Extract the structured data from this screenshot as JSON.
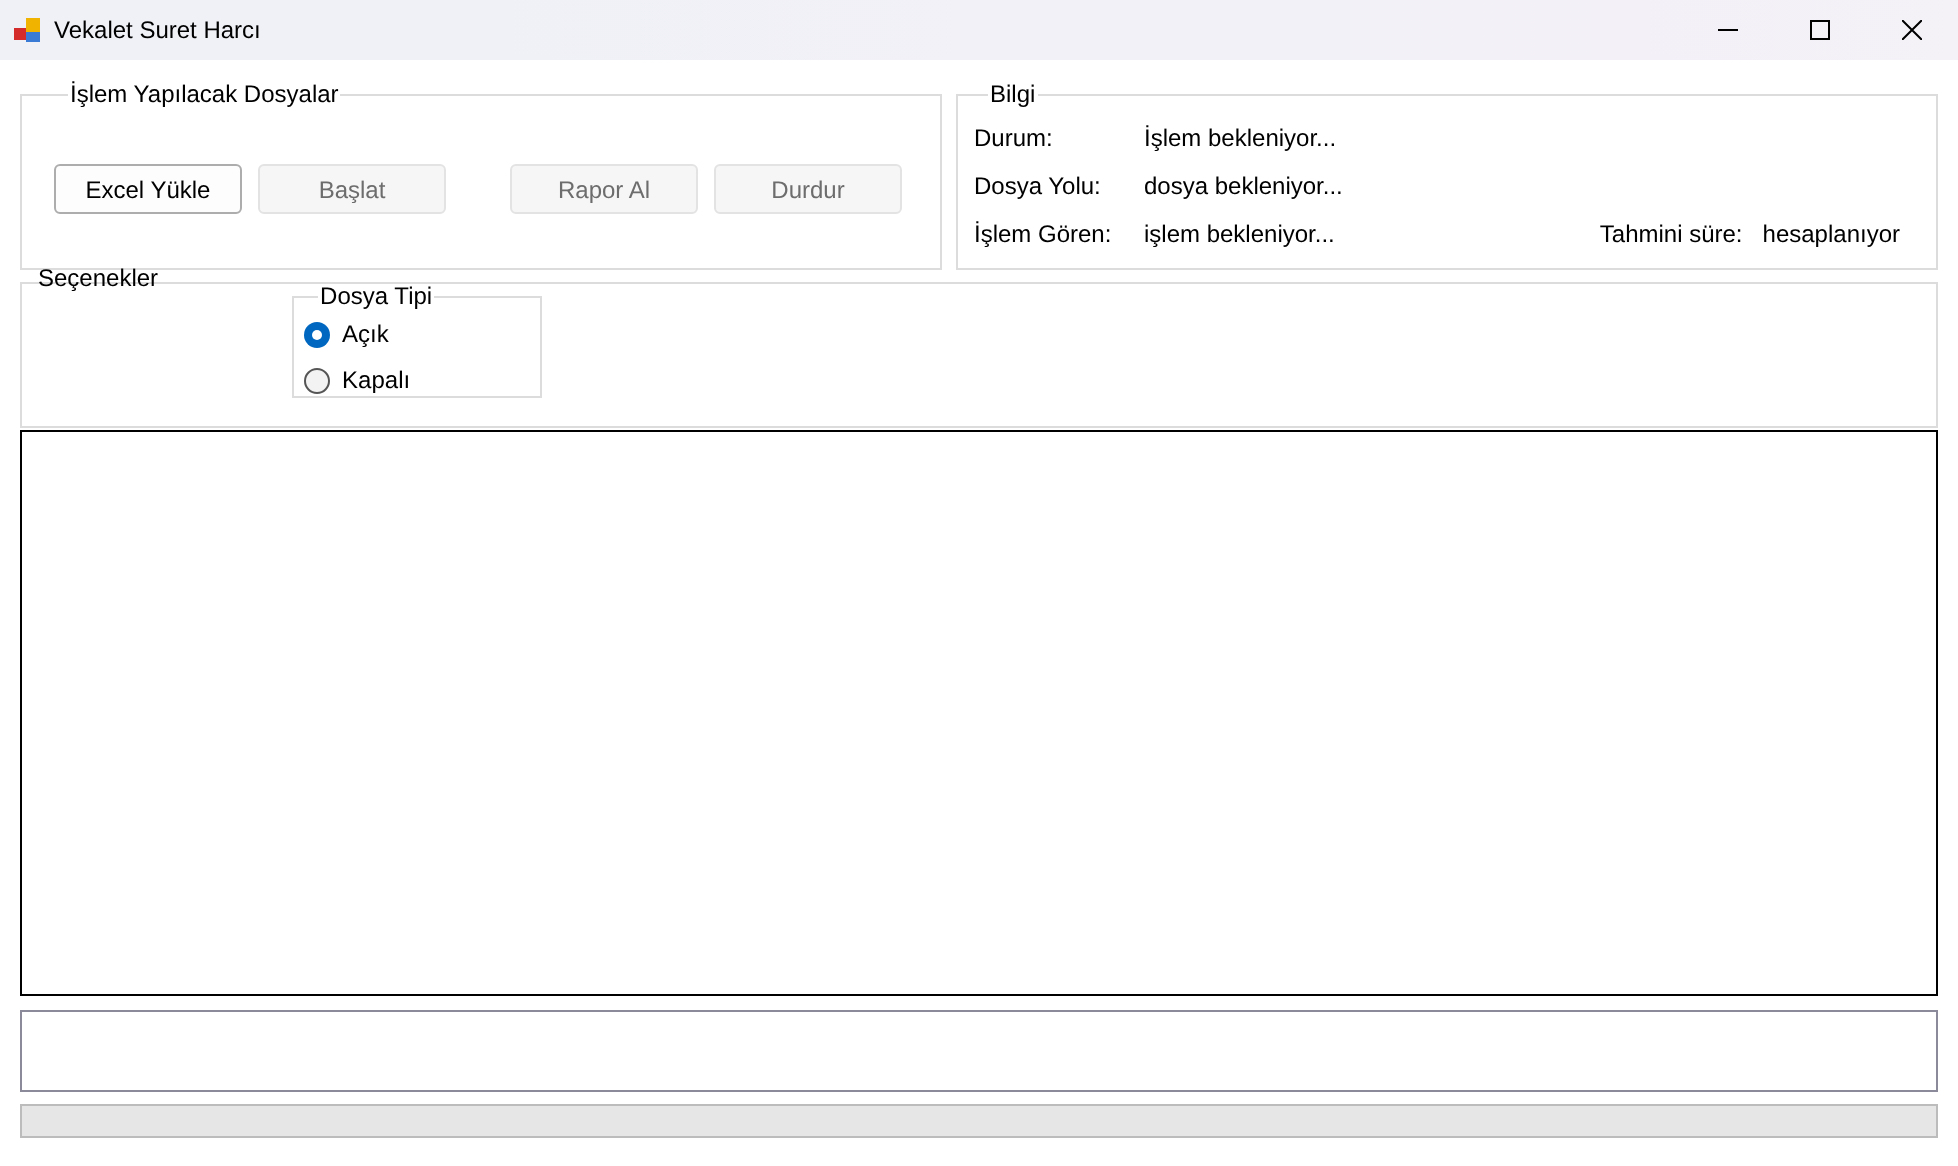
{
  "window": {
    "title": "Vekalet Suret Harcı"
  },
  "files_group": {
    "title": "İşlem Yapılacak Dosyalar",
    "buttons": [
      {
        "label": "Excel Yükle",
        "disabled": false
      },
      {
        "label": "Başlat",
        "disabled": true
      },
      {
        "label": "Rapor Al",
        "disabled": true
      },
      {
        "label": "Durdur",
        "disabled": true
      }
    ]
  },
  "info_group": {
    "title": "Bilgi",
    "rows": [
      {
        "label": "Durum:",
        "value": "İşlem bekleniyor..."
      },
      {
        "label": "Dosya Yolu:",
        "value": "dosya bekleniyor..."
      },
      {
        "label": "İşlem Gören:",
        "value": "işlem bekleniyor..."
      }
    ],
    "estimate": {
      "label": "Tahmini süre:",
      "value": "hesaplanıyor"
    }
  },
  "options_group": {
    "title": "Seçenekler",
    "file_type": {
      "title": "Dosya Tipi",
      "options": [
        {
          "label": "Açık",
          "selected": true
        },
        {
          "label": "Kapalı",
          "selected": false
        }
      ]
    }
  },
  "progress": {
    "level": 0
  }
}
